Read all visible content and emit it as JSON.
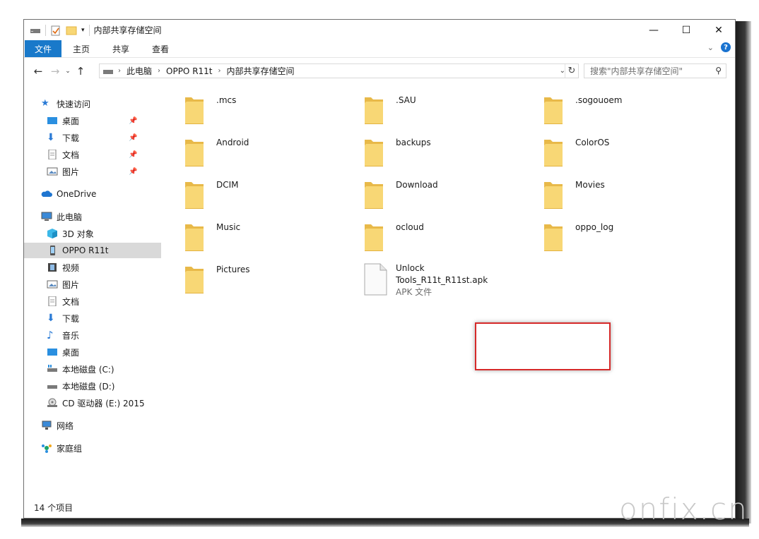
{
  "window": {
    "title": "内部共享存储空间",
    "controls": {
      "minimize": "—",
      "maximize": "☐",
      "close": "✕"
    }
  },
  "ribbon": {
    "tabs": [
      "文件",
      "主页",
      "共享",
      "查看"
    ]
  },
  "address": {
    "crumbs": [
      "此电脑",
      "OPPO R11t",
      "内部共享存储空间"
    ],
    "search_placeholder": "搜索\"内部共享存储空间\""
  },
  "nav": {
    "quick_access": "快速访问",
    "quick_items": [
      "桌面",
      "下载",
      "文档",
      "图片"
    ],
    "onedrive": "OneDrive",
    "this_pc": "此电脑",
    "pc_items": [
      "3D 对象",
      "OPPO R11t",
      "视频",
      "图片",
      "文档",
      "下载",
      "音乐",
      "桌面",
      "本地磁盘 (C:)",
      "本地磁盘 (D:)",
      "CD 驱动器 (E:) 2015"
    ],
    "network": "网络",
    "homegroup": "家庭组"
  },
  "files": {
    "folders": [
      ".mcs",
      ".SAU",
      ".sogouoem",
      "Android",
      "backups",
      "ColorOS",
      "DCIM",
      "Download",
      "Movies",
      "Music",
      "ocloud",
      "oppo_log",
      "Pictures"
    ],
    "apk": {
      "name_line1": "Unlock",
      "name_line2": "Tools_R11t_R11st.apk",
      "type": "APK 文件"
    }
  },
  "status": {
    "item_count": "14 个项目"
  },
  "watermark": "onfix.cn",
  "colors": {
    "file_tab": "#1979ca",
    "folder": "#f8d775",
    "folder_dark": "#e8b949",
    "highlight": "#d62929",
    "selected_nav": "#d9d9d9"
  }
}
